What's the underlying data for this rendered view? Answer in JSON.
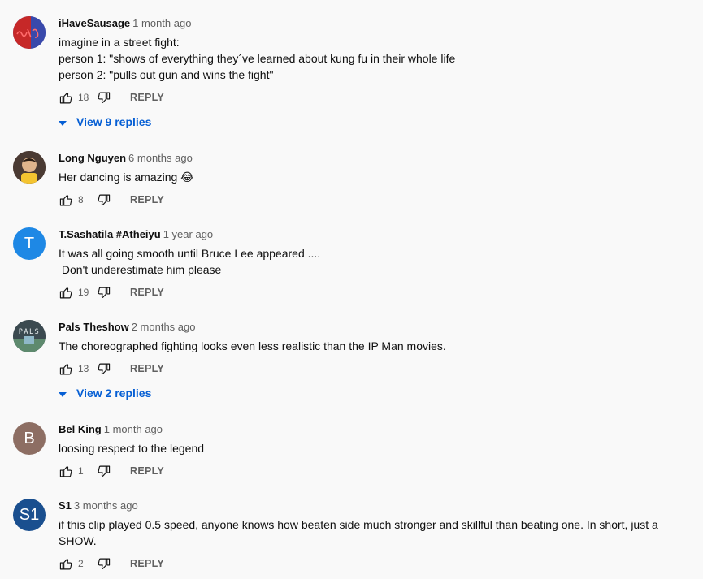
{
  "labels": {
    "reply": "REPLY"
  },
  "comments": [
    {
      "author": "iHaveSausage",
      "time": "1 month ago",
      "lines": [
        "imagine in a street fight:",
        "person 1: \"shows of everything they´ve learned about kung fu in their whole life",
        "person 2: \"pulls out gun and wins the fight\""
      ],
      "likes": "18",
      "replies": "View 9 replies",
      "avatar": {
        "type": "image",
        "description": "red and blue split with red scribble",
        "colors": [
          "#c62828",
          "#3949ab"
        ]
      }
    },
    {
      "author": "Long Nguyen",
      "time": "6 months ago",
      "lines": [
        "Her dancing is amazing 😂"
      ],
      "likes": "8",
      "replies": "",
      "avatar": {
        "type": "image",
        "description": "child photo",
        "colors": [
          "#6d4c41",
          "#f4c430"
        ]
      }
    },
    {
      "author": "T.Sashatila #Atheiyu",
      "time": "1 year ago",
      "lines": [
        "It was all going smooth until Bruce Lee appeared ....",
        " Don't underestimate him please"
      ],
      "likes": "19",
      "replies": "",
      "avatar": {
        "type": "letter",
        "letter": "T",
        "color": "#1e88e5"
      }
    },
    {
      "author": "Pals Theshow",
      "time": "2 months ago",
      "lines": [
        "The choreographed fighting looks even less realistic than the IP Man movies."
      ],
      "likes": "13",
      "replies": "View 2 replies",
      "avatar": {
        "type": "image",
        "description": "PALS logo",
        "text": "PALS",
        "colors": [
          "#37474f",
          "#5e8a6e"
        ]
      }
    },
    {
      "author": "Bel King",
      "time": "1 month ago",
      "lines": [
        "loosing respect to the legend"
      ],
      "likes": "1",
      "replies": "",
      "avatar": {
        "type": "letter",
        "letter": "B",
        "color": "#8d6e63"
      }
    },
    {
      "author": "S1",
      "time": "3 months ago",
      "lines": [
        "if this clip played 0.5 speed, anyone knows how beaten side much stronger and skillful than beating one. In short, just a SHOW."
      ],
      "likes": "2",
      "replies": "",
      "avatar": {
        "type": "letter",
        "letter": "S1",
        "color": "#1a4f8f"
      }
    }
  ],
  "icons": {
    "like": "thumb-up-icon",
    "dislike": "thumb-down-icon",
    "expand": "caret-down-icon"
  },
  "colors": {
    "background": "#f9f9f9",
    "link": "#065fd4",
    "secondary_text": "#606060"
  }
}
